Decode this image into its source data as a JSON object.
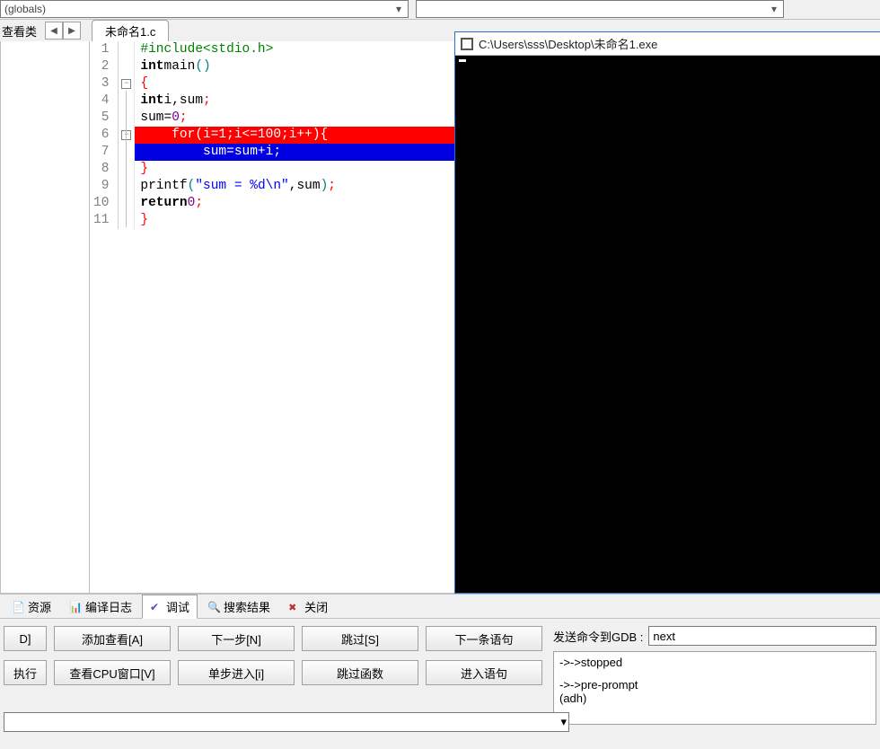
{
  "top": {
    "combo1_text": "(globals)",
    "combo2_text": ""
  },
  "sidebar_label": "查看类",
  "file_tab": "未命名1.c",
  "code": {
    "lines": [
      {
        "n": 1,
        "html": "<span class='tk-pp'>#include&lt;stdio.h&gt;</span>"
      },
      {
        "n": 2,
        "html": "<span class='tk-kw'>int</span> <span class='tk-fn'>main</span><span class='tk-par'>()</span>"
      },
      {
        "n": 3,
        "html": "<span class='tk-brace'>{</span>",
        "fold": true
      },
      {
        "n": 4,
        "html": "    <span class='tk-kw'>int</span> <span class='tk-id'>i</span><span class='tk-op'>,</span><span class='tk-id'>sum</span><span class='tk-semi'>;</span>"
      },
      {
        "n": 5,
        "html": "    <span class='tk-id'>sum</span><span class='tk-op'>=</span><span class='tk-num'>0</span><span class='tk-semi'>;</span>"
      },
      {
        "n": 6,
        "html": "    for(i=1;i<=100;i++){",
        "hl": "red",
        "bp": true,
        "fold": true
      },
      {
        "n": 7,
        "html": "        sum=sum+i;",
        "hl": "blue",
        "arrow": true
      },
      {
        "n": 8,
        "html": "    <span class='tk-brace'>}</span>"
      },
      {
        "n": 9,
        "html": "    <span class='tk-fn'>printf</span><span class='tk-par'>(</span><span class='tk-str'>\"sum = %d\\n\"</span><span class='tk-op'>,</span><span class='tk-id'>sum</span><span class='tk-par'>)</span><span class='tk-semi'>;</span>"
      },
      {
        "n": 10,
        "html": "    <span class='tk-kw'>return</span> <span class='tk-num'>0</span><span class='tk-semi'>;</span>"
      },
      {
        "n": 11,
        "html": "<span class='tk-brace'>}</span>"
      }
    ]
  },
  "console": {
    "title": "C:\\Users\\sss\\Desktop\\未命名1.exe"
  },
  "bottom_tabs": {
    "resources": "资源",
    "compile_log": "编译日志",
    "debug": "调试",
    "search_results": "搜索结果",
    "close": "关闭"
  },
  "debug_buttons": {
    "r1c1": "D]",
    "r1c2": "添加查看[A]",
    "r1c3": "下一步[N]",
    "r1c4": "跳过[S]",
    "r1c5": "下一条语句",
    "r2c1": "执行",
    "r2c2": "查看CPU窗口[V]",
    "r2c3": "单步进入[i]",
    "r2c4": "跳过函数",
    "r2c5": "进入语句"
  },
  "gdb": {
    "label": "发送命令到GDB :",
    "input_value": "next",
    "out1": "->->stopped",
    "out2": "->->pre-prompt",
    "out3": "(adh)"
  }
}
